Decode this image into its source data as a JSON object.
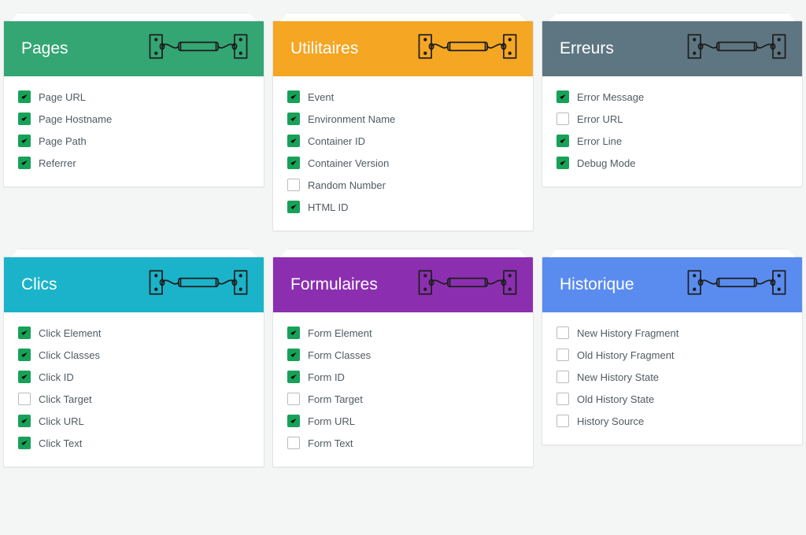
{
  "colors": {
    "pages": "#34a673",
    "utilitaires": "#f5a623",
    "erreurs": "#5e7682",
    "clics": "#1bb3c9",
    "formulaires": "#8b2fb0",
    "historique": "#5a8cf0",
    "check": "#18a158"
  },
  "panels": [
    {
      "id": "pages",
      "title": "Pages",
      "items": [
        {
          "label": "Page URL",
          "checked": true
        },
        {
          "label": "Page Hostname",
          "checked": true
        },
        {
          "label": "Page Path",
          "checked": true
        },
        {
          "label": "Referrer",
          "checked": true
        }
      ]
    },
    {
      "id": "utilitaires",
      "title": "Utilitaires",
      "items": [
        {
          "label": "Event",
          "checked": true
        },
        {
          "label": "Environment Name",
          "checked": true
        },
        {
          "label": "Container ID",
          "checked": true
        },
        {
          "label": "Container Version",
          "checked": true
        },
        {
          "label": "Random Number",
          "checked": false
        },
        {
          "label": "HTML ID",
          "checked": true
        }
      ]
    },
    {
      "id": "erreurs",
      "title": "Erreurs",
      "items": [
        {
          "label": "Error Message",
          "checked": true
        },
        {
          "label": "Error URL",
          "checked": false
        },
        {
          "label": "Error Line",
          "checked": true
        },
        {
          "label": "Debug Mode",
          "checked": true
        }
      ]
    },
    {
      "id": "clics",
      "title": "Clics",
      "items": [
        {
          "label": "Click Element",
          "checked": true
        },
        {
          "label": "Click Classes",
          "checked": true
        },
        {
          "label": "Click ID",
          "checked": true
        },
        {
          "label": "Click Target",
          "checked": false
        },
        {
          "label": "Click URL",
          "checked": true
        },
        {
          "label": "Click Text",
          "checked": true
        }
      ]
    },
    {
      "id": "formulaires",
      "title": "Formulaires",
      "items": [
        {
          "label": "Form Element",
          "checked": true
        },
        {
          "label": "Form Classes",
          "checked": true
        },
        {
          "label": "Form ID",
          "checked": true
        },
        {
          "label": "Form Target",
          "checked": false
        },
        {
          "label": "Form URL",
          "checked": true
        },
        {
          "label": "Form Text",
          "checked": false
        }
      ]
    },
    {
      "id": "historique",
      "title": "Historique",
      "items": [
        {
          "label": "New History Fragment",
          "checked": false
        },
        {
          "label": "Old History Fragment",
          "checked": false
        },
        {
          "label": "New History State",
          "checked": false
        },
        {
          "label": "Old History State",
          "checked": false
        },
        {
          "label": "History Source",
          "checked": false
        }
      ]
    }
  ]
}
